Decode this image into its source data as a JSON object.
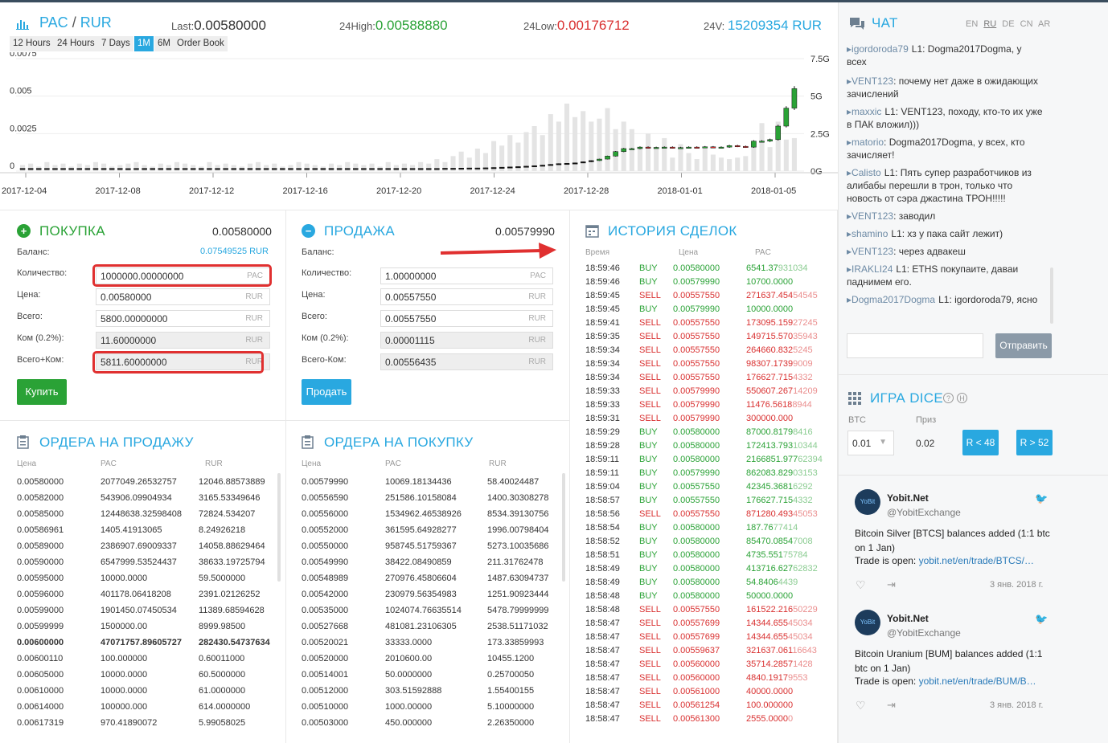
{
  "header": {
    "pair_base": "PAC",
    "pair_sep": "/",
    "pair_quote": "RUR",
    "last_label": "Last:",
    "last_value": "0.00580000",
    "high_label": "24High:",
    "high_value": "0.00588880",
    "low_label": "24Low:",
    "low_value": "0.00176712",
    "vol_label": "24V:",
    "vol_value": "15209354 RUR",
    "timeframes": [
      "12 Hours",
      "24 Hours",
      "7 Days",
      "1M",
      "6M",
      "Order Book"
    ],
    "active_timeframe": "1M"
  },
  "chart_data": {
    "type": "candlestick",
    "x_dates": [
      "2017-12-04",
      "2017-12-08",
      "2017-12-12",
      "2017-12-16",
      "2017-12-20",
      "2017-12-24",
      "2017-12-28",
      "2018-01-01",
      "2018-01-05"
    ],
    "y_ticks_left": [
      "0.0075",
      "0.005",
      "0.0025",
      "0"
    ],
    "y_ticks_right": [
      "7.5G",
      "5G",
      "2.5G",
      "0G"
    ],
    "ylim_price": [
      0,
      0.0075
    ],
    "ylim_volume": [
      0,
      7.5
    ],
    "price_close": [
      0.00018,
      0.00017,
      0.00018,
      0.00017,
      0.00018,
      0.00018,
      0.00017,
      0.00018,
      0.00018,
      0.00017,
      0.00018,
      0.00018,
      0.00017,
      0.00017,
      0.00018,
      0.00018,
      0.00017,
      0.00018,
      0.00018,
      0.00017,
      0.00018,
      0.00018,
      0.00017,
      0.00018,
      0.00018,
      0.00017,
      0.00018,
      0.00018,
      0.00018,
      0.00017,
      0.00018,
      0.00018,
      0.00018,
      0.00017,
      0.00018,
      0.00018,
      0.00018,
      0.00017,
      0.00018,
      0.00018,
      0.00018,
      0.00017,
      0.00018,
      0.00018,
      0.00018,
      0.00017,
      0.00018,
      0.00018,
      0.00018,
      0.00017,
      0.00018,
      0.00018,
      0.00019,
      0.00018,
      0.0002,
      0.00021,
      0.00019,
      0.00022,
      0.00024,
      0.00026,
      0.00028,
      0.0003,
      0.00033,
      0.00036,
      0.0004,
      0.00045,
      0.0005,
      0.00052,
      0.00055,
      0.00062,
      0.0007,
      0.0008,
      0.001,
      0.0013,
      0.0015,
      0.0015,
      0.0016,
      0.00155,
      0.00158,
      0.0016,
      0.00155,
      0.00157,
      0.0016,
      0.00158,
      0.00162,
      0.00158,
      0.0016,
      0.0017,
      0.00165,
      0.0016,
      0.002,
      0.002,
      0.0021,
      0.003,
      0.0042,
      0.0055
    ],
    "volume": [
      0.4,
      0.5,
      0.3,
      0.6,
      0.4,
      0.5,
      0.3,
      0.5,
      0.4,
      0.6,
      0.5,
      0.3,
      0.4,
      0.5,
      0.6,
      0.4,
      0.3,
      0.5,
      0.4,
      0.6,
      0.5,
      0.4,
      0.3,
      0.6,
      0.4,
      0.5,
      0.4,
      0.3,
      0.5,
      0.6,
      0.4,
      0.5,
      0.3,
      0.4,
      0.6,
      0.5,
      0.4,
      0.3,
      0.5,
      0.4,
      0.6,
      0.5,
      0.4,
      0.5,
      0.3,
      0.6,
      0.4,
      0.5,
      0.4,
      0.6,
      0.5,
      0.8,
      0.6,
      1.0,
      1.3,
      0.9,
      1.5,
      1.2,
      2.0,
      1.7,
      2.4,
      1.9,
      2.6,
      3.0,
      2.4,
      3.8,
      3.3,
      4.5,
      3.6,
      4.0,
      3.3,
      3.5,
      4.2,
      2.8,
      3.3,
      2.8,
      1.5,
      2.5,
      1.6,
      2.2,
      0.9,
      1.8,
      1.2,
      0.8,
      1.5,
      1.1,
      0.9,
      0.8,
      0.9,
      1.0,
      2.0,
      3.2,
      1.6,
      3.3,
      2.1,
      2.2
    ]
  },
  "buy_panel": {
    "title": "ПОКУПКА",
    "price": "0.00580000",
    "balance_label": "Баланс:",
    "balance_value": "0.07549525 RUR",
    "qty_label": "Количество:",
    "qty_value": "1000000.00000000",
    "qty_cur": "PAC",
    "price_label": "Цена:",
    "price_value": "0.00580000",
    "price_cur": "RUR",
    "total_label": "Всего:",
    "total_value": "5800.00000000",
    "total_cur": "RUR",
    "fee_label": "Ком (0.2%):",
    "fee_value": "11.60000000",
    "fee_cur": "RUR",
    "sumfee_label": "Всего+Ком:",
    "sumfee_value": "5811.60000000",
    "sumfee_cur": "RUR",
    "button": "Купить"
  },
  "sell_panel": {
    "title": "ПРОДАЖА",
    "price": "0.00579990",
    "balance_label": "Баланс:",
    "balance_value": "",
    "qty_label": "Количество:",
    "qty_value": "1.00000000",
    "qty_cur": "PAC",
    "price_label": "Цена:",
    "price_value": "0.00557550",
    "price_cur": "RUR",
    "total_label": "Всего:",
    "total_value": "0.00557550",
    "total_cur": "RUR",
    "fee_label": "Ком (0.2%):",
    "fee_value": "0.00001115",
    "fee_cur": "RUR",
    "subfee_label": "Всего-Ком:",
    "subfee_value": "0.00556435",
    "subfee_cur": "RUR",
    "button": "Продать"
  },
  "sell_orders": {
    "title": "ОРДЕРА НА ПРОДАЖУ",
    "headers": [
      "Цена",
      "PAC",
      "RUR"
    ],
    "rows": [
      [
        "0.00580000",
        "2077049.26532757",
        "12046.88573889"
      ],
      [
        "0.00582000",
        "543906.09904934",
        "3165.53349646"
      ],
      [
        "0.00585000",
        "12448638.32598408",
        "72824.534207"
      ],
      [
        "0.00586961",
        "1405.41913065",
        "8.24926218"
      ],
      [
        "0.00589000",
        "2386907.69009337",
        "14058.88629464"
      ],
      [
        "0.00590000",
        "6547999.53524437",
        "38633.19725794"
      ],
      [
        "0.00595000",
        "10000.0000",
        "59.5000000"
      ],
      [
        "0.00596000",
        "401178.06418208",
        "2391.02126252"
      ],
      [
        "0.00599000",
        "1901450.07450534",
        "11389.68594628"
      ],
      [
        "0.00599999",
        "1500000.00",
        "8999.98500"
      ],
      [
        "0.00600000",
        "47071757.89605727",
        "282430.54737634"
      ],
      [
        "0.00600110",
        "100.000000",
        "0.60011000"
      ],
      [
        "0.00605000",
        "10000.0000",
        "60.5000000"
      ],
      [
        "0.00610000",
        "10000.0000",
        "61.0000000"
      ],
      [
        "0.00614000",
        "100000.000",
        "614.0000000"
      ],
      [
        "0.00617319",
        "970.41890072",
        "5.99058025"
      ]
    ]
  },
  "buy_orders": {
    "title": "ОРДЕРА НА ПОКУПКУ",
    "headers": [
      "Цена",
      "PAC",
      "RUR"
    ],
    "rows": [
      [
        "0.00579990",
        "10069.18134436",
        "58.40024487"
      ],
      [
        "0.00556590",
        "251586.10158084",
        "1400.30308278"
      ],
      [
        "0.00556000",
        "1534962.46538926",
        "8534.39130756"
      ],
      [
        "0.00552000",
        "361595.64928277",
        "1996.00798404"
      ],
      [
        "0.00550000",
        "958745.51759367",
        "5273.10035686"
      ],
      [
        "0.00549990",
        "38422.08490859",
        "211.31762478"
      ],
      [
        "0.00548989",
        "270976.45806604",
        "1487.63094737"
      ],
      [
        "0.00542000",
        "230979.56354983",
        "1251.90923444"
      ],
      [
        "0.00535000",
        "1024074.76635514",
        "5478.79999999"
      ],
      [
        "0.00527668",
        "481081.23106305",
        "2538.51171032"
      ],
      [
        "0.00520021",
        "33333.0000",
        "173.33859993"
      ],
      [
        "0.00520000",
        "2010600.00",
        "10455.1200"
      ],
      [
        "0.00514001",
        "50.0000000",
        "0.25700050"
      ],
      [
        "0.00512000",
        "303.51592888",
        "1.55400155"
      ],
      [
        "0.00510000",
        "1000.00000",
        "5.10000000"
      ],
      [
        "0.00503000",
        "450.000000",
        "2.26350000"
      ]
    ]
  },
  "trade_history": {
    "title": "ИСТОРИЯ СДЕЛОК",
    "headers": [
      "Время",
      "Цена",
      "PAC"
    ],
    "rows": [
      [
        "18:59:46",
        "BUY",
        "0.00580000",
        "6541.37",
        "931034"
      ],
      [
        "18:59:46",
        "BUY",
        "0.00579990",
        "10700.0000",
        ""
      ],
      [
        "18:59:45",
        "SELL",
        "0.00557550",
        "271637.454",
        "54545"
      ],
      [
        "18:59:45",
        "BUY",
        "0.00579990",
        "10000.0000",
        ""
      ],
      [
        "18:59:41",
        "SELL",
        "0.00557550",
        "173095.159",
        "27245"
      ],
      [
        "18:59:35",
        "SELL",
        "0.00557550",
        "149715.570",
        "35943"
      ],
      [
        "18:59:34",
        "SELL",
        "0.00557550",
        "264660.832",
        "5245"
      ],
      [
        "18:59:34",
        "SELL",
        "0.00557550",
        "98307.1739",
        "9009"
      ],
      [
        "18:59:34",
        "SELL",
        "0.00557550",
        "176627.715",
        "4332"
      ],
      [
        "18:59:33",
        "SELL",
        "0.00579990",
        "550607.267",
        "14209"
      ],
      [
        "18:59:33",
        "SELL",
        "0.00579990",
        "11476.5618",
        "8944"
      ],
      [
        "18:59:31",
        "SELL",
        "0.00579990",
        "300000.000",
        ""
      ],
      [
        "18:59:29",
        "BUY",
        "0.00580000",
        "87000.8179",
        "8416"
      ],
      [
        "18:59:28",
        "BUY",
        "0.00580000",
        "172413.793",
        "10344"
      ],
      [
        "18:59:11",
        "BUY",
        "0.00580000",
        "2166851.977",
        "62394"
      ],
      [
        "18:59:11",
        "BUY",
        "0.00579990",
        "862083.829",
        "03153"
      ],
      [
        "18:59:04",
        "BUY",
        "0.00557550",
        "42345.3681",
        "6292"
      ],
      [
        "18:58:57",
        "BUY",
        "0.00557550",
        "176627.715",
        "4332"
      ],
      [
        "18:58:56",
        "SELL",
        "0.00557550",
        "871280.493",
        "45053"
      ],
      [
        "18:58:54",
        "BUY",
        "0.00580000",
        "187.76",
        "77414"
      ],
      [
        "18:58:52",
        "BUY",
        "0.00580000",
        "85470.0854",
        "7008"
      ],
      [
        "18:58:51",
        "BUY",
        "0.00580000",
        "4735.551",
        "75784"
      ],
      [
        "18:58:49",
        "BUY",
        "0.00580000",
        "413716.627",
        "62832"
      ],
      [
        "18:58:49",
        "BUY",
        "0.00580000",
        "54.8406",
        "4439"
      ],
      [
        "18:58:48",
        "BUY",
        "0.00580000",
        "50000.0000",
        ""
      ],
      [
        "18:58:48",
        "SELL",
        "0.00557550",
        "161522.216",
        "50229"
      ],
      [
        "18:58:47",
        "SELL",
        "0.00557699",
        "14344.655",
        "45034"
      ],
      [
        "18:58:47",
        "SELL",
        "0.00557699",
        "14344.655",
        "45034"
      ],
      [
        "18:58:47",
        "SELL",
        "0.00559637",
        "321637.061",
        "16643"
      ],
      [
        "18:58:47",
        "SELL",
        "0.00560000",
        "35714.2857",
        "1428"
      ],
      [
        "18:58:47",
        "SELL",
        "0.00560000",
        "4840.1917",
        "9553"
      ],
      [
        "18:58:47",
        "SELL",
        "0.00561000",
        "40000.0000",
        ""
      ],
      [
        "18:58:47",
        "SELL",
        "0.00561254",
        "100.000000",
        ""
      ],
      [
        "18:58:47",
        "SELL",
        "0.00561300",
        "2555.0000",
        "0"
      ]
    ]
  },
  "chat": {
    "title": "ЧАТ",
    "langs": [
      "EN",
      "RU",
      "DE",
      "CN",
      "AR"
    ],
    "active_lang": "RU",
    "messages": [
      {
        "user": "igordoroda79",
        "level": "L1:",
        "text": " Dogma2017Dogma, у всех"
      },
      {
        "user": "VENT123",
        "level": "",
        "text": ": почему нет даже в ожидающих зачислений"
      },
      {
        "user": "maxxic",
        "level": "L1:",
        "text": " VENT123, походу, кто-то их уже в ПАК вложил)))"
      },
      {
        "user": "matorio",
        "level": "",
        "text": ": Dogma2017Dogma, у всех, кто зачисляет!"
      },
      {
        "user": "Calisto",
        "level": "L1:",
        "text": " Пять супер разработчиков из алибабы перешли в трон, только что новость от сэра джастина ТРОН!!!!!"
      },
      {
        "user": "VENT123",
        "level": "",
        "text": ": заводил"
      },
      {
        "user": "shamino",
        "level": "L1:",
        "text": " хз у пака сайт лежит)"
      },
      {
        "user": "VENT123",
        "level": "",
        "text": ": через адвакеш"
      },
      {
        "user": "IRAKLI24",
        "level": "L1:",
        "text": " ETHS покупаите, даваи паднимем его."
      },
      {
        "user": "Dogma2017Dogma",
        "level": "L1:",
        "text": " igordoroda79, ясно"
      }
    ],
    "send_button": "Отправить",
    "input_value": ""
  },
  "dice": {
    "title": "ИГРА DICE",
    "btc_label": "BTC",
    "prize_label": "Приз",
    "bet_value": "0.01",
    "prize_value": "0.02",
    "btn_low": "R < 48",
    "btn_high": "R > 52"
  },
  "tweets": [
    {
      "name": "Yobit.Net",
      "handle": "@YobitExchange",
      "text1": "Bitcoin Silver [BTCS] balances added (1:1 btc on 1 Jan)",
      "text2": "Trade is open: ",
      "link": "yobit.net/en/trade/BTCS/…",
      "date": "3 янв. 2018 г."
    },
    {
      "name": "Yobit.Net",
      "handle": "@YobitExchange",
      "text1": "Bitcoin Uranium [BUM] balances added (1:1 btc on 1 Jan)",
      "text2": "Trade is open: ",
      "link": "yobit.net/en/trade/BUM/B…",
      "date": "3 янв. 2018 г."
    }
  ],
  "colors": {
    "accent": "#29a8e0",
    "buy": "#2aa236",
    "sell": "#d93030",
    "annotation": "#e03030"
  }
}
